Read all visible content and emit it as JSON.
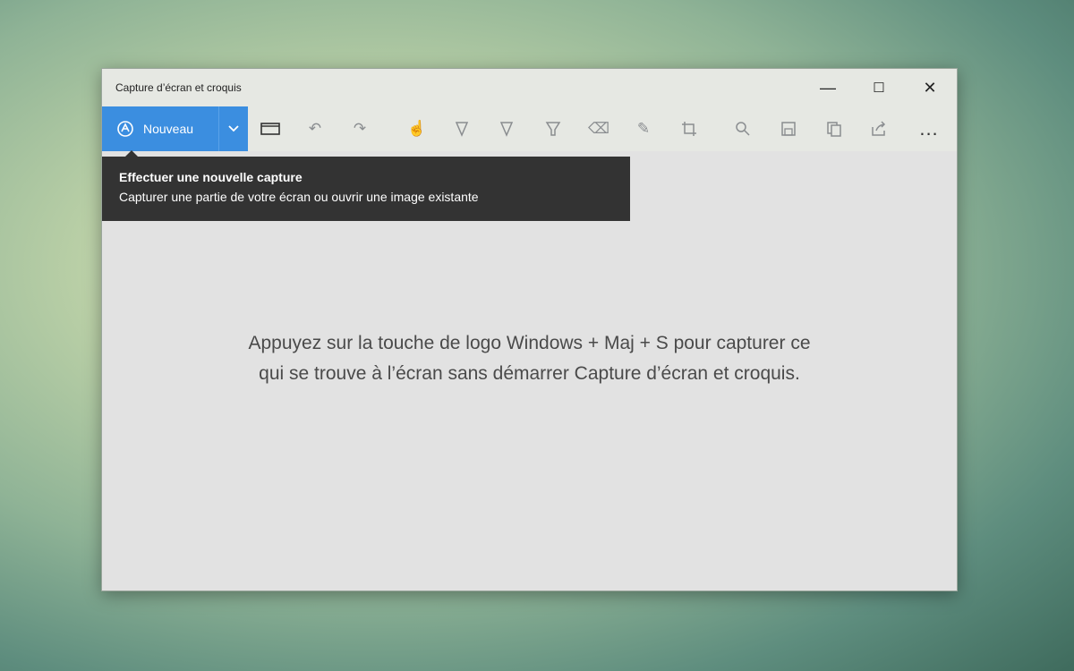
{
  "window": {
    "title": "Capture d’écran et croquis",
    "controls": {
      "minimize": "—",
      "maximize": "☐",
      "close": "✕"
    }
  },
  "toolbar": {
    "new_label": "Nouveau",
    "more_label": "..."
  },
  "tooltip": {
    "title": "Effectuer une nouvelle capture",
    "description": "Capturer une partie de votre écran ou ouvrir une image existante"
  },
  "canvas": {
    "hint": "Appuyez sur la touche de logo Windows + Maj + S pour capturer ce qui se trouve à l’écran sans démarrer Capture d’écran et croquis."
  },
  "colors": {
    "accent": "#3b8ee0",
    "tooltip_bg": "#333333",
    "canvas_bg": "#e2e2e2"
  }
}
